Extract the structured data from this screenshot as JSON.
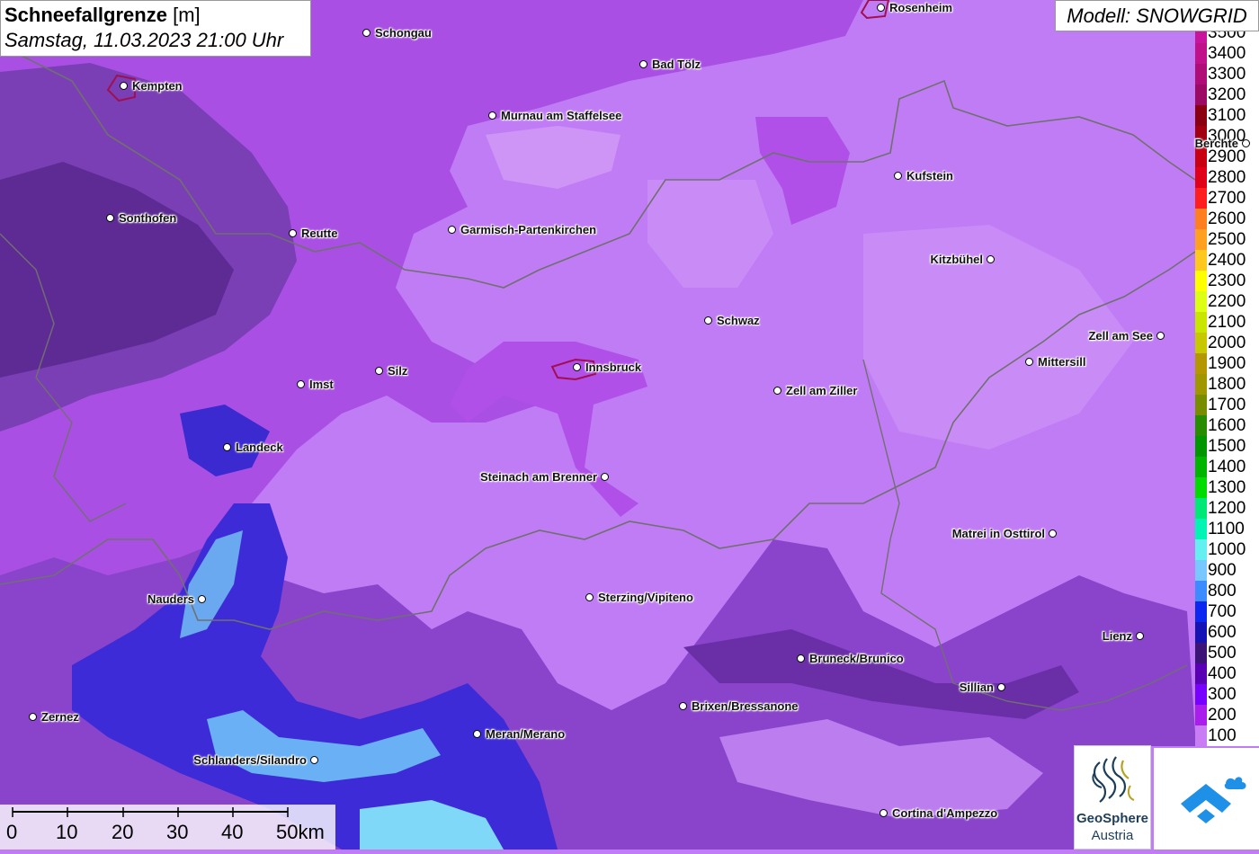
{
  "title": {
    "bold": "Schneefallgrenze",
    "unit": "[m]",
    "datetime": "Samstag, 11.03.2023 21:00 Uhr"
  },
  "model": "Modell: SNOWGRID",
  "legend": [
    {
      "label": "3500",
      "color": "#c8169c"
    },
    {
      "label": "3400",
      "color": "#c0108a"
    },
    {
      "label": "3300",
      "color": "#b00c78"
    },
    {
      "label": "3200",
      "color": "#9c0a66"
    },
    {
      "label": "3100",
      "color": "#8a0010"
    },
    {
      "label": "3000",
      "color": "#a00010"
    },
    {
      "label": "2900",
      "color": "#c80012"
    },
    {
      "label": "2800",
      "color": "#e00018"
    },
    {
      "label": "2700",
      "color": "#ff1e1e"
    },
    {
      "label": "2600",
      "color": "#ff7f1e"
    },
    {
      "label": "2500",
      "color": "#ffa020"
    },
    {
      "label": "2400",
      "color": "#ffc81e"
    },
    {
      "label": "2300",
      "color": "#ffff00"
    },
    {
      "label": "2200",
      "color": "#dcff14"
    },
    {
      "label": "2100",
      "color": "#c8e600"
    },
    {
      "label": "2000",
      "color": "#c8c800"
    },
    {
      "label": "1900",
      "color": "#b49600"
    },
    {
      "label": "1800",
      "color": "#a09600"
    },
    {
      "label": "1700",
      "color": "#788c00"
    },
    {
      "label": "1600",
      "color": "#288c00"
    },
    {
      "label": "1500",
      "color": "#009600"
    },
    {
      "label": "1400",
      "color": "#00b400"
    },
    {
      "label": "1300",
      "color": "#00dc00"
    },
    {
      "label": "1200",
      "color": "#00e878"
    },
    {
      "label": "1100",
      "color": "#00f5b4"
    },
    {
      "label": "1000",
      "color": "#64f0f0"
    },
    {
      "label": "900",
      "color": "#78c8ff"
    },
    {
      "label": "800",
      "color": "#3c8cff"
    },
    {
      "label": "700",
      "color": "#0a28f0"
    },
    {
      "label": "600",
      "color": "#1414b4"
    },
    {
      "label": "500",
      "color": "#3c1478"
    },
    {
      "label": "400",
      "color": "#5a00b4"
    },
    {
      "label": "300",
      "color": "#7800ff"
    },
    {
      "label": "200",
      "color": "#aa1eeb"
    },
    {
      "label": "100",
      "color": "#c87df5"
    }
  ],
  "cities": [
    {
      "name": "Rosenheim",
      "side": "right"
    },
    {
      "name": "Schongau",
      "side": "right"
    },
    {
      "name": "Bad Tölz",
      "side": "right"
    },
    {
      "name": "Kempten",
      "side": "right"
    },
    {
      "name": "Murnau am Staffelsee",
      "side": "right"
    },
    {
      "name": "Berchte",
      "side": "left"
    },
    {
      "name": "Kufstein",
      "side": "right"
    },
    {
      "name": "Sonthofen",
      "side": "right"
    },
    {
      "name": "Reutte",
      "side": "right"
    },
    {
      "name": "Garmisch-Partenkirchen",
      "side": "right"
    },
    {
      "name": "Kitzbühel",
      "side": "left"
    },
    {
      "name": "Schwaz",
      "side": "right"
    },
    {
      "name": "Zell am See",
      "side": "left"
    },
    {
      "name": "Mittersill",
      "side": "right"
    },
    {
      "name": "Innsbruck",
      "side": "right"
    },
    {
      "name": "Silz",
      "side": "right"
    },
    {
      "name": "Imst",
      "side": "right"
    },
    {
      "name": "Zell am Ziller",
      "side": "right"
    },
    {
      "name": "Landeck",
      "side": "right"
    },
    {
      "name": "Steinach am Brenner",
      "side": "left"
    },
    {
      "name": "Matrei in Osttirol",
      "side": "left"
    },
    {
      "name": "Nauders",
      "side": "left"
    },
    {
      "name": "Sterzing/Vipiteno",
      "side": "right"
    },
    {
      "name": "Lienz",
      "side": "left"
    },
    {
      "name": "Bruneck/Brunico",
      "side": "right"
    },
    {
      "name": "Sillian",
      "side": "left"
    },
    {
      "name": "Brixen/Bressanone",
      "side": "right"
    },
    {
      "name": "Zernez",
      "side": "right"
    },
    {
      "name": "Meran/Merano",
      "side": "right"
    },
    {
      "name": "Schlanders/Silandro",
      "side": "left"
    },
    {
      "name": "Cortina d'Ampezzo",
      "side": "right"
    }
  ],
  "scale": {
    "ticks": [
      "0",
      "10",
      "20",
      "30",
      "40",
      "50km"
    ]
  },
  "logos": {
    "geosphere_name": "GeoSphere",
    "geosphere_sub": "Austria"
  }
}
